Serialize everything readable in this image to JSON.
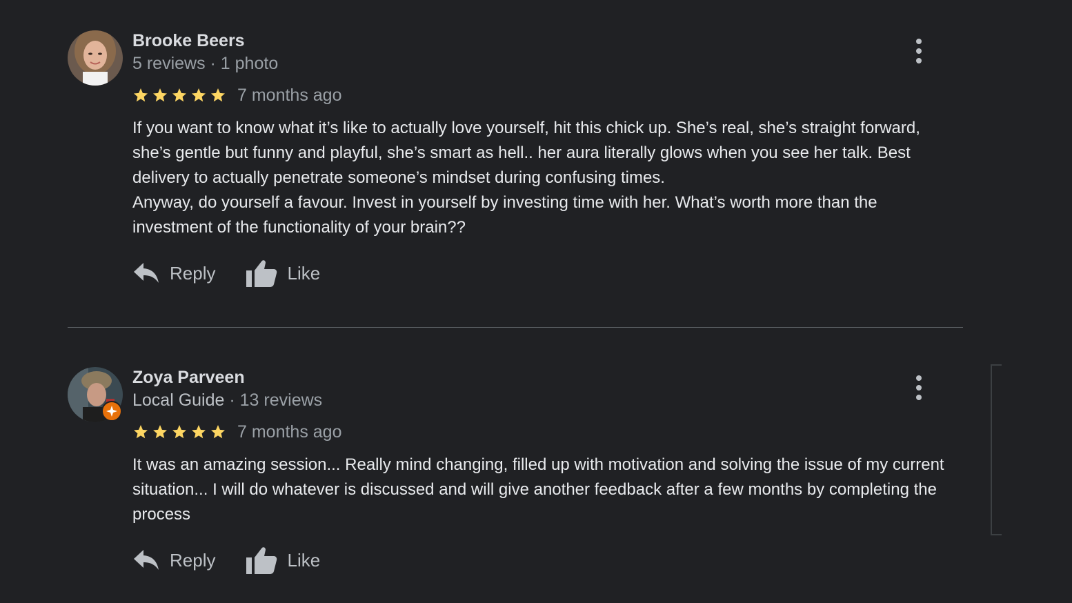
{
  "reviews": [
    {
      "name": "Brooke Beers",
      "meta": "5 reviews · 1 photo",
      "rating": 5,
      "date": "7 months ago",
      "text": "If you want to know what it’s like to actually love yourself, hit this chick up. She’s real, she’s straight forward, she’s gentle but funny and playful, she’s smart as hell.. her aura literally glows when you see her talk. Best delivery to actually penetrate someone’s mindset during confusing times.\nAnyway, do yourself a favour. Invest in yourself by investing time with her. What’s worth more than the investment of the functionality of your brain??",
      "reply_label": "Reply",
      "like_label": "Like"
    },
    {
      "name": "Zoya Parveen",
      "guide_label": "Local Guide",
      "meta": " · 13 reviews",
      "rating": 5,
      "date": "7 months ago",
      "text": "It was an amazing session... Really mind changing, filled up with motivation and solving the issue of my current situation... I will do whatever is discussed and will give another feedback after a few months by completing the process",
      "reply_label": "Reply",
      "like_label": "Like"
    }
  ],
  "colors": {
    "background": "#202124",
    "star": "#fdd663",
    "local_guide_badge": "#e8710a"
  },
  "icons": [
    "reply-icon",
    "thumbs-up-icon",
    "more-vert-icon",
    "star-icon",
    "local-guide-badge-icon"
  ]
}
